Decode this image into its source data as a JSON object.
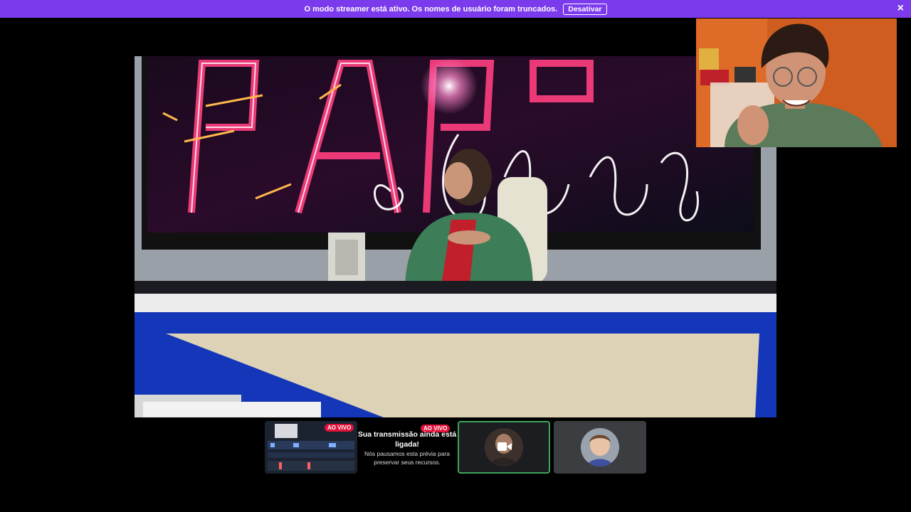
{
  "banner": {
    "message": "O modo streamer está ativo. Os nomes de usuário foram truncados.",
    "button_label": "Desativar",
    "close_glyph": "×"
  },
  "stream_tiles": {
    "live_label": "AO VIVO",
    "preview_live_label": "AO VIVO",
    "preview_title": "Sua transmissão ainda está ligada!",
    "preview_body": "Nós pausamos esta prévia para preservar seus recursos."
  },
  "icons": {
    "camera": "video-camera-icon",
    "close": "close-icon"
  },
  "colors": {
    "banner": "#7c3aed",
    "live_badge": "#e0123a",
    "active_speaker_border": "#3ba55c"
  }
}
